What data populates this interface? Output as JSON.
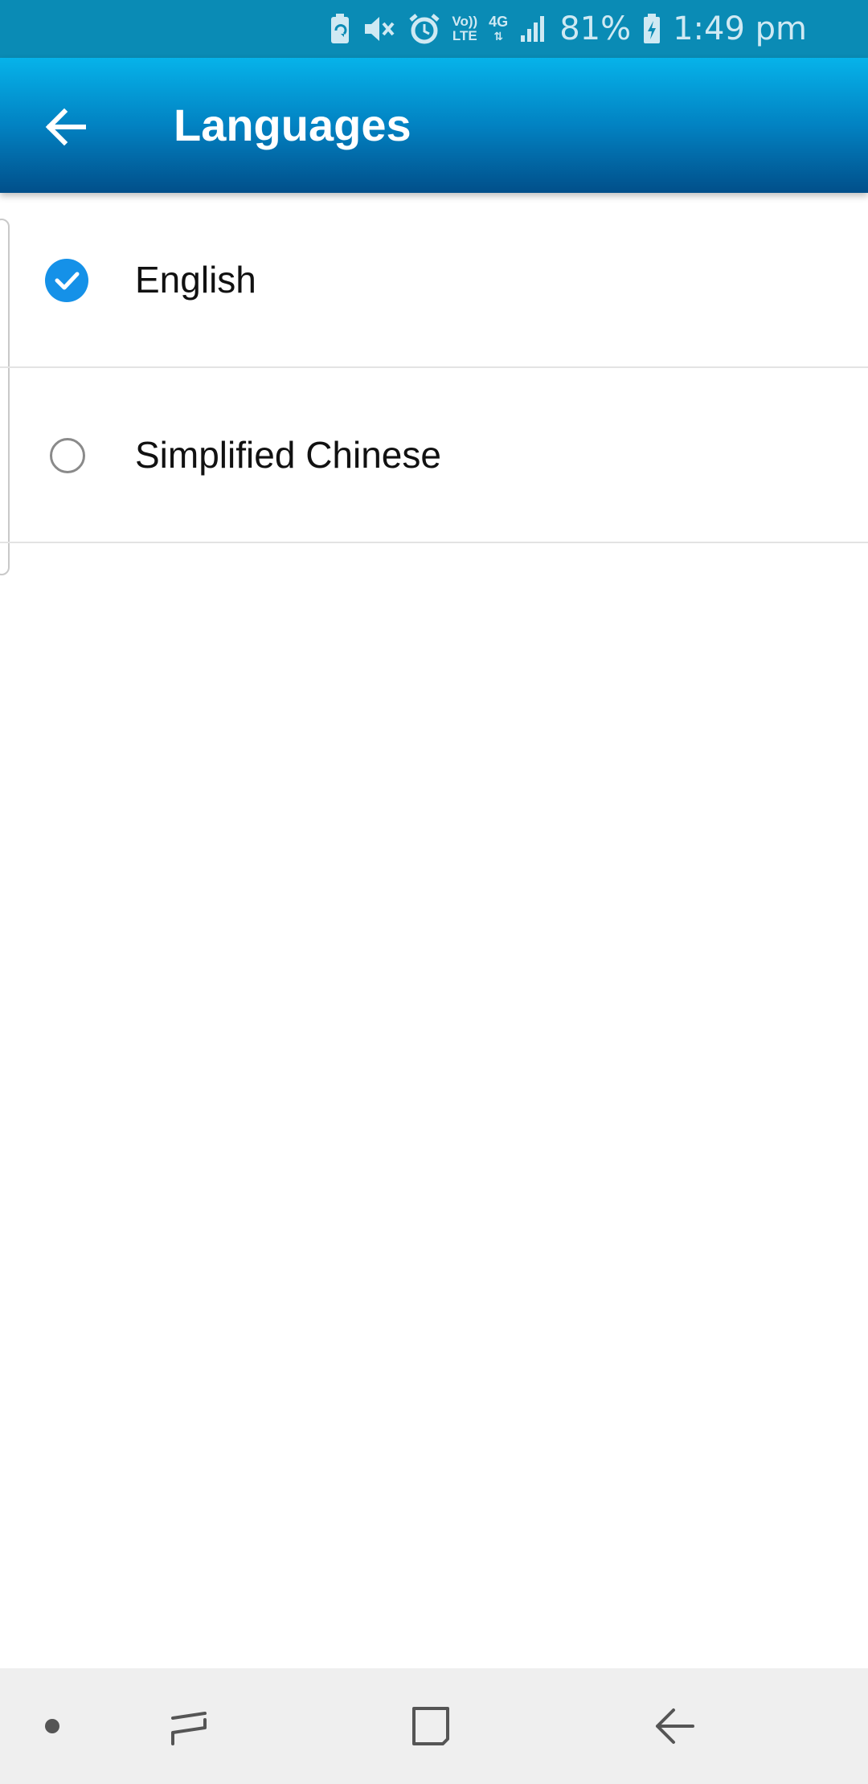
{
  "status_bar": {
    "battery_percent": "81%",
    "time": "1:49 pm",
    "volte_top": "Vo))",
    "volte_bottom": "LTE",
    "network_type": "4G",
    "icons": [
      "battery-saver-icon",
      "mute-icon",
      "alarm-icon",
      "volte-icon",
      "network-4g-icon",
      "signal-icon",
      "battery-charging-icon"
    ]
  },
  "app_bar": {
    "title": "Languages",
    "back_icon": "arrow-left-icon"
  },
  "languages": {
    "items": [
      {
        "label": "English",
        "selected": true
      },
      {
        "label": "Simplified Chinese",
        "selected": false
      }
    ]
  },
  "nav_bar": {
    "icons": [
      "dot-icon",
      "recent-apps-icon",
      "home-icon",
      "back-icon"
    ]
  },
  "colors": {
    "status_bar_bg": "#0a8bb5",
    "app_bar_top": "#06b3ea",
    "app_bar_bottom": "#014f8a",
    "accent": "#1591e8",
    "nav_bar_bg": "#efefef"
  }
}
